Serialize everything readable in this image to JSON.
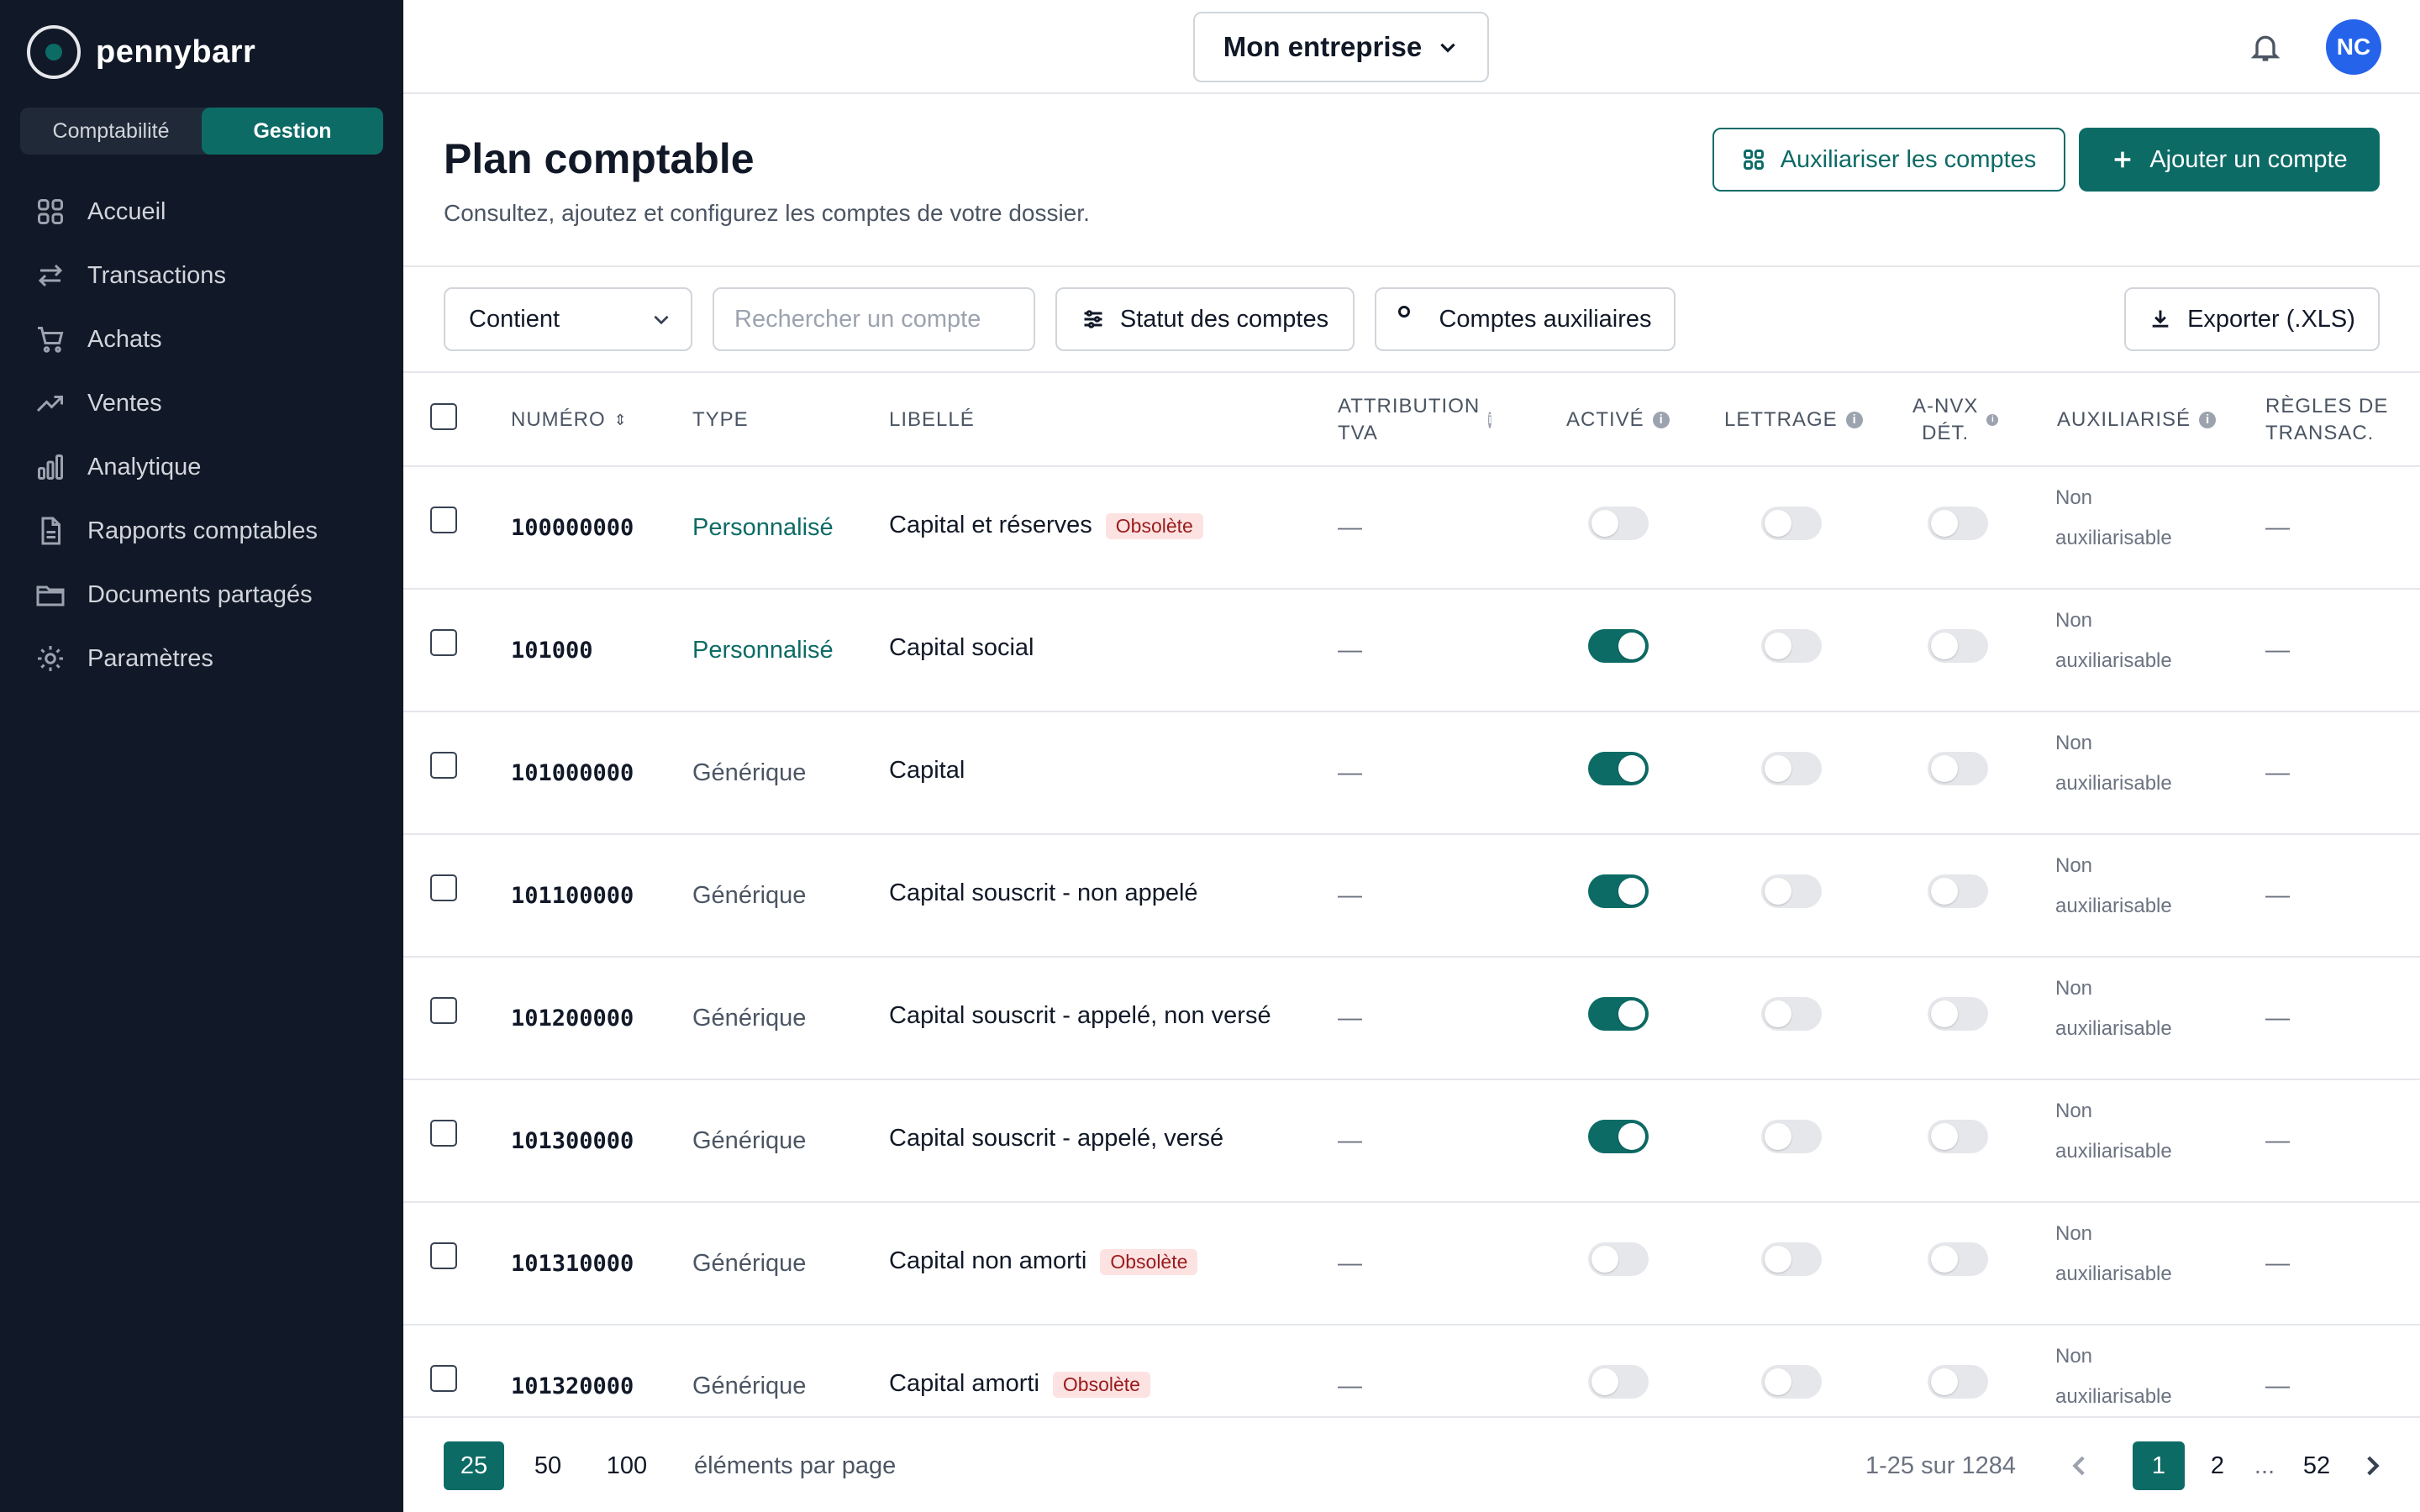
{
  "brand": {
    "name": "pennybarr",
    "accent": "#0d6b66",
    "sidebar_bg": "#111827"
  },
  "sidebar": {
    "segments": [
      {
        "label": "Comptabilité",
        "active": false
      },
      {
        "label": "Gestion",
        "active": true
      }
    ],
    "items": [
      {
        "label": "Accueil",
        "icon": "grid-icon"
      },
      {
        "label": "Transactions",
        "icon": "arrows-swap-icon"
      },
      {
        "label": "Achats",
        "icon": "cart-icon"
      },
      {
        "label": "Ventes",
        "icon": "trend-up-icon"
      },
      {
        "label": "Analytique",
        "icon": "bar-chart-icon"
      },
      {
        "label": "Rapports comptables",
        "icon": "document-icon"
      },
      {
        "label": "Documents partagés",
        "icon": "folder-icon"
      },
      {
        "label": "Paramètres",
        "icon": "gear-icon"
      }
    ]
  },
  "topbar": {
    "company": "Mon entreprise",
    "avatar_initials": "NC"
  },
  "header": {
    "title": "Plan comptable",
    "subtitle": "Consultez, ajoutez et configurez les comptes de votre dossier.",
    "btn_aux": "Auxiliariser les comptes",
    "btn_add": "Ajouter un compte"
  },
  "filters": {
    "match_mode": "Contient",
    "search_placeholder": "Rechercher un compte",
    "status": "Statut des comptes",
    "aux": "Comptes auxiliaires",
    "export": "Exporter (.XLS)"
  },
  "table": {
    "columns": {
      "numero": "NUMÉRO",
      "type": "TYPE",
      "libelle": "LIBELLÉ",
      "tva_1": "ATTRIBUTION",
      "tva_2": "TVA",
      "active": "ACTIVÉ",
      "lettrage": "LETTRAGE",
      "anvx_1": "A-NVX",
      "anvx_2": "DÉT.",
      "aux": "AUXILIARISÉ",
      "regles_1": "RÈGLES DE",
      "regles_2": "TRANSAC."
    },
    "rows": [
      {
        "numero": "100000000",
        "type": "Personnalisé",
        "libelle": "Capital et réserves",
        "badge": "Obsolète",
        "tva": "—",
        "active": false,
        "lettrage": false,
        "anvx": false,
        "aux_1": "Non",
        "aux_2": "auxiliarisable",
        "regles": "—"
      },
      {
        "numero": "101000",
        "type": "Personnalisé",
        "libelle": "Capital social",
        "badge": "",
        "tva": "—",
        "active": true,
        "lettrage": false,
        "anvx": false,
        "aux_1": "Non",
        "aux_2": "auxiliarisable",
        "regles": "—"
      },
      {
        "numero": "101000000",
        "type": "Générique",
        "libelle": "Capital",
        "badge": "",
        "tva": "—",
        "active": true,
        "lettrage": false,
        "anvx": false,
        "aux_1": "Non",
        "aux_2": "auxiliarisable",
        "regles": "—"
      },
      {
        "numero": "101100000",
        "type": "Générique",
        "libelle": "Capital souscrit - non appelé",
        "badge": "",
        "tva": "—",
        "active": true,
        "lettrage": false,
        "anvx": false,
        "aux_1": "Non",
        "aux_2": "auxiliarisable",
        "regles": "—"
      },
      {
        "numero": "101200000",
        "type": "Générique",
        "libelle": "Capital souscrit - appelé, non versé",
        "badge": "",
        "tva": "—",
        "active": true,
        "lettrage": false,
        "anvx": false,
        "aux_1": "Non",
        "aux_2": "auxiliarisable",
        "regles": "—"
      },
      {
        "numero": "101300000",
        "type": "Générique",
        "libelle": "Capital souscrit - appelé, versé",
        "badge": "",
        "tva": "—",
        "active": true,
        "lettrage": false,
        "anvx": false,
        "aux_1": "Non",
        "aux_2": "auxiliarisable",
        "regles": "—"
      },
      {
        "numero": "101310000",
        "type": "Générique",
        "libelle": "Capital non amorti",
        "badge": "Obsolète",
        "tva": "—",
        "active": false,
        "lettrage": false,
        "anvx": false,
        "aux_1": "Non",
        "aux_2": "auxiliarisable",
        "regles": "—"
      },
      {
        "numero": "101320000",
        "type": "Générique",
        "libelle": "Capital amorti",
        "badge": "Obsolète",
        "tva": "—",
        "active": false,
        "lettrage": false,
        "anvx": false,
        "aux_1": "Non",
        "aux_2": "auxiliarisable",
        "regles": "—"
      }
    ]
  },
  "pagination": {
    "page_sizes": [
      "25",
      "50",
      "100"
    ],
    "selected_page_size": "25",
    "page_size_label": "éléments par page",
    "range": "1-25 sur 1284",
    "pages": [
      "1",
      "2",
      "...",
      "52"
    ],
    "current_page": "1"
  }
}
